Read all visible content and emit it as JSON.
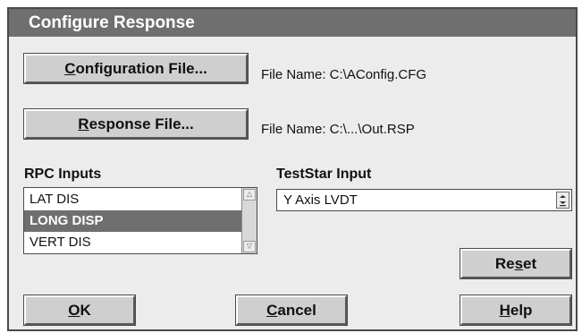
{
  "dialog": {
    "title": "Configure Response"
  },
  "config": {
    "button_mnemonic": "C",
    "button_rest": "onfiguration File...",
    "file_label": "File Name:  C:\\AConfig.CFG"
  },
  "response": {
    "button_mnemonic": "R",
    "button_rest": "esponse File...",
    "file_label": "File Name:  C:\\...\\Out.RSP"
  },
  "rpc_inputs": {
    "heading": "RPC Inputs",
    "items": [
      "LAT DIS",
      "LONG DISP",
      "VERT DIS"
    ],
    "selected_index": 1
  },
  "teststar_input": {
    "heading": "TestStar Input",
    "value": "Y Axis LVDT"
  },
  "buttons": {
    "reset": {
      "pre": "Re",
      "mnemonic": "s",
      "post": "et"
    },
    "ok": {
      "mnemonic": "O",
      "rest": "K"
    },
    "cancel": {
      "mnemonic": "C",
      "rest": "ancel"
    },
    "help": {
      "mnemonic": "H",
      "rest": "elp"
    }
  }
}
